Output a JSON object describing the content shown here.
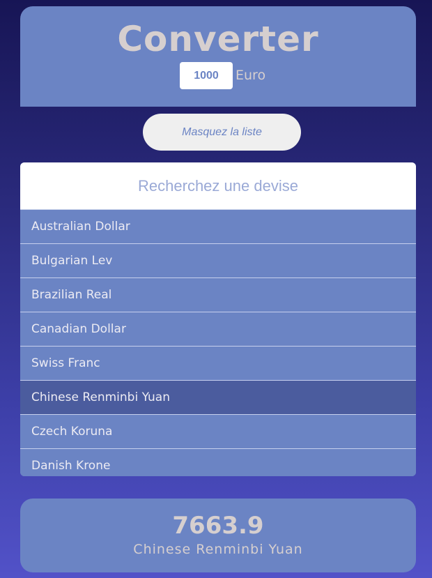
{
  "header": {
    "title": "Converter",
    "amount_value": "1000",
    "base_currency": "Euro"
  },
  "toggle_button": {
    "label": "Masquez la liste"
  },
  "search": {
    "placeholder": "Recherchez une devise",
    "value": ""
  },
  "currency_list": {
    "items": [
      {
        "label": "Australian Dollar",
        "selected": false
      },
      {
        "label": "Bulgarian Lev",
        "selected": false
      },
      {
        "label": "Brazilian Real",
        "selected": false
      },
      {
        "label": "Canadian Dollar",
        "selected": false
      },
      {
        "label": "Swiss Franc",
        "selected": false
      },
      {
        "label": "Chinese Renminbi Yuan",
        "selected": true
      },
      {
        "label": "Czech Koruna",
        "selected": false
      },
      {
        "label": "Danish Krone",
        "selected": false
      }
    ]
  },
  "result": {
    "value": "7663.9",
    "currency": "Chinese Renminbi Yuan"
  },
  "colors": {
    "accent": "#6b84c4",
    "selected_row": "#4b5c9e",
    "text_light": "#d6cfcf",
    "background_top": "#171555",
    "background_bottom": "#5252c8"
  }
}
